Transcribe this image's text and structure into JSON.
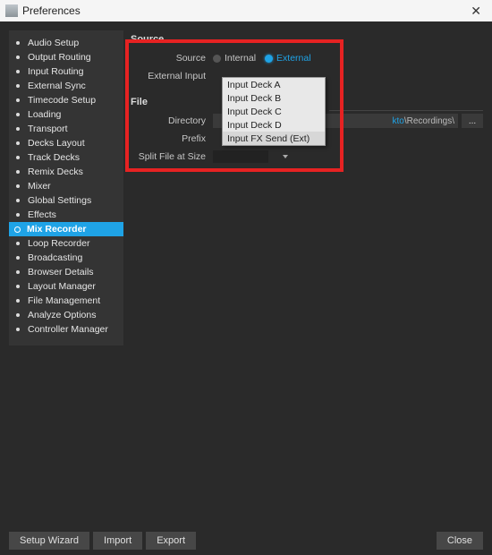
{
  "window": {
    "title": "Preferences"
  },
  "sidebar": {
    "items": [
      {
        "label": "Audio Setup"
      },
      {
        "label": "Output Routing"
      },
      {
        "label": "Input Routing"
      },
      {
        "label": "External Sync"
      },
      {
        "label": "Timecode Setup"
      },
      {
        "label": "Loading"
      },
      {
        "label": "Transport"
      },
      {
        "label": "Decks Layout"
      },
      {
        "label": "Track Decks"
      },
      {
        "label": "Remix Decks"
      },
      {
        "label": "Mixer"
      },
      {
        "label": "Global Settings"
      },
      {
        "label": "Effects"
      },
      {
        "label": "Mix Recorder",
        "active": true
      },
      {
        "label": "Loop Recorder"
      },
      {
        "label": "Broadcasting"
      },
      {
        "label": "Browser Details"
      },
      {
        "label": "Layout Manager"
      },
      {
        "label": "File Management"
      },
      {
        "label": "Analyze Options"
      },
      {
        "label": "Controller Manager"
      }
    ]
  },
  "source": {
    "section": "Source",
    "source_label": "Source",
    "internal": "Internal",
    "external": "External",
    "selected": "External",
    "external_input_label": "External Input",
    "dropdown": {
      "options": [
        "Input Deck A",
        "Input Deck B",
        "Input Deck C",
        "Input Deck D",
        "Input FX Send (Ext)"
      ],
      "selected_index": 4
    }
  },
  "file": {
    "section": "File",
    "directory_label": "Directory",
    "directory_hl": "kto",
    "directory_path": "\\Recordings\\",
    "browse": "...",
    "prefix_label": "Prefix",
    "split_label": "Split File at Size"
  },
  "footer": {
    "setup_wizard": "Setup Wizard",
    "import": "Import",
    "export": "Export",
    "close": "Close"
  }
}
